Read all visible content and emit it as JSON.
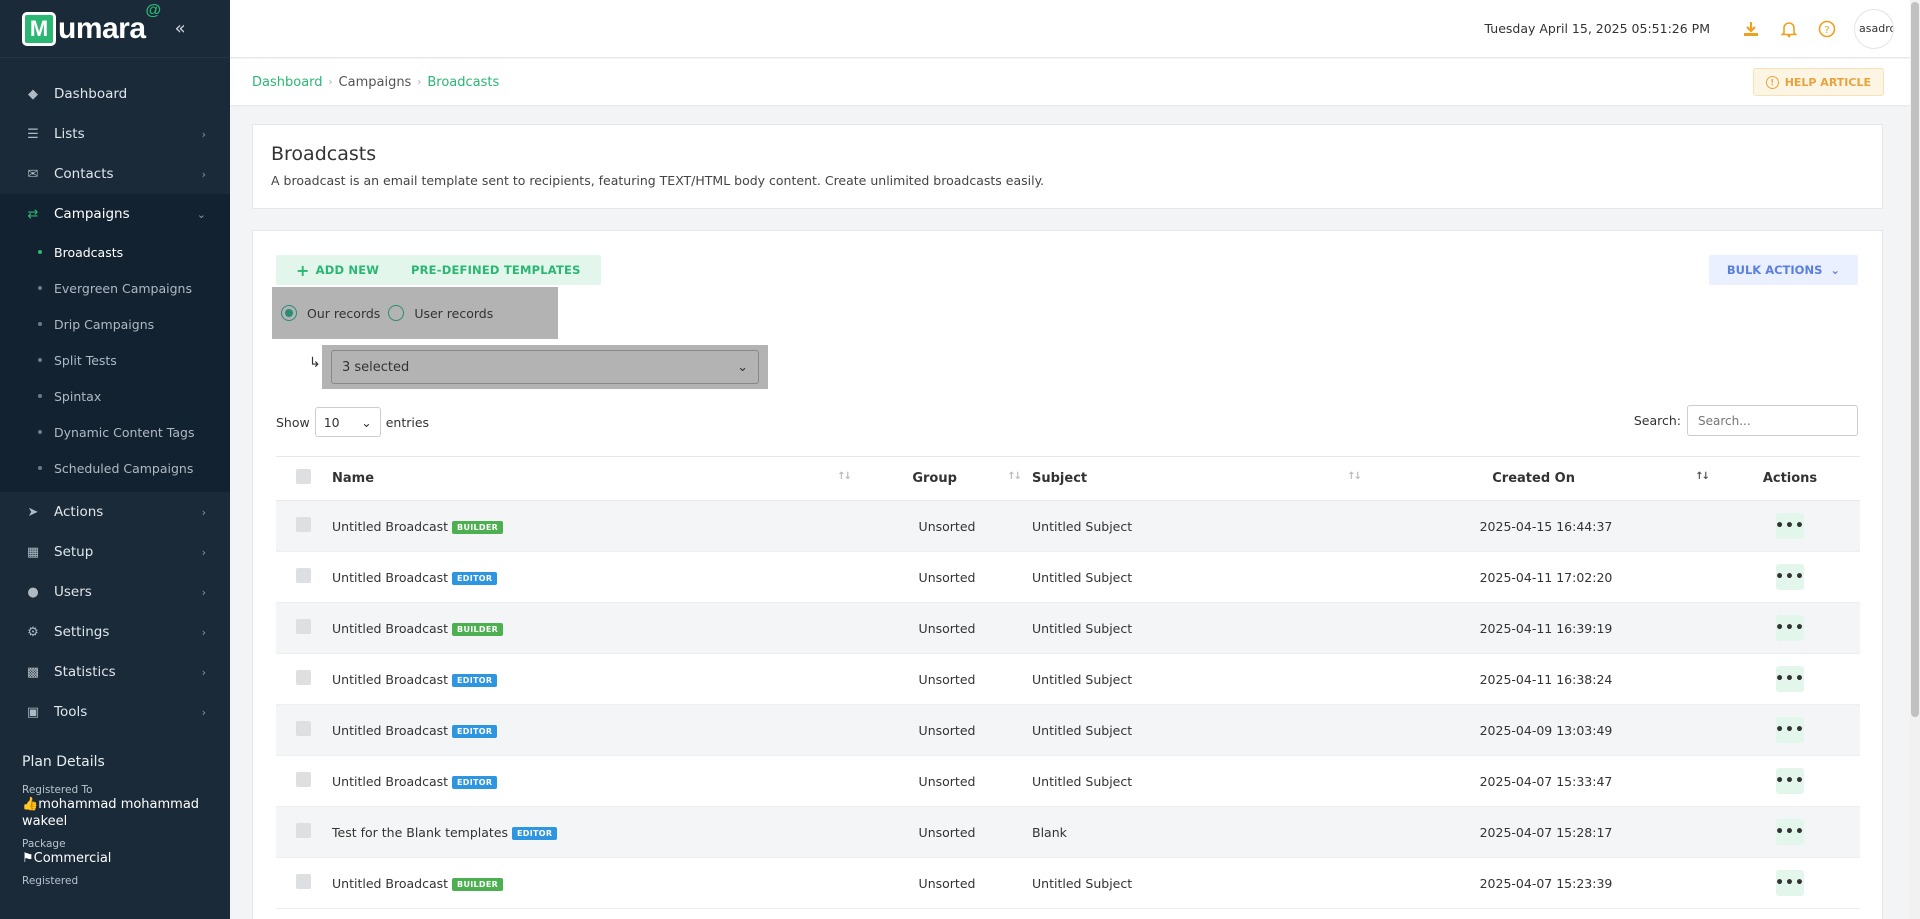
{
  "brand": {
    "letter": "M",
    "name": "umara",
    "sup": "@"
  },
  "topbar": {
    "datetime": "Tuesday April 15, 2025 05:51:26 PM",
    "avatar_alt": "asadro"
  },
  "sidebar": {
    "items": [
      {
        "label": "Dashboard",
        "icon": "diamond-icon"
      },
      {
        "label": "Lists",
        "icon": "list-icon"
      },
      {
        "label": "Contacts",
        "icon": "mail-icon"
      },
      {
        "label": "Campaigns",
        "icon": "campaign-icon"
      },
      {
        "label": "Actions",
        "icon": "actions-icon"
      },
      {
        "label": "Setup",
        "icon": "setup-icon"
      },
      {
        "label": "Users",
        "icon": "user-icon"
      },
      {
        "label": "Settings",
        "icon": "gear-icon"
      },
      {
        "label": "Statistics",
        "icon": "chart-icon"
      },
      {
        "label": "Tools",
        "icon": "tools-icon"
      }
    ],
    "campaign_sub": [
      "Broadcasts",
      "Evergreen Campaigns",
      "Drip Campaigns",
      "Split Tests",
      "Spintax",
      "Dynamic Content Tags",
      "Scheduled Campaigns"
    ],
    "plan": {
      "title": "Plan Details",
      "registered_to_label": "Registered To",
      "registered_to": "mohammad mohammad wakeel",
      "package_label": "Package",
      "package": "Commercial",
      "registered_label": "Registered"
    }
  },
  "breadcrumb": {
    "c1": "Dashboard",
    "c2": "Campaigns",
    "c3": "Broadcasts"
  },
  "help_label": "HELP ARTICLE",
  "header": {
    "title": "Broadcasts",
    "description": "A broadcast is an email template sent to recipients, featuring TEXT/HTML body content. Create unlimited broadcasts easily."
  },
  "toolbar": {
    "add_new": "ADD NEW",
    "predefined": "PRE-DEFINED TEMPLATES",
    "bulk": "BULK ACTIONS"
  },
  "records": {
    "ours": "Our records",
    "users": "User records",
    "selected": "3 selected"
  },
  "table_controls": {
    "show": "Show",
    "length": "10",
    "entries": "entries",
    "search_label": "Search:",
    "search_placeholder": "Search..."
  },
  "columns": {
    "name": "Name",
    "group": "Group",
    "subject": "Subject",
    "created": "Created On",
    "actions": "Actions"
  },
  "rows": [
    {
      "name": "Untitled Broadcast",
      "tag": "BUILDER",
      "group": "Unsorted",
      "subject": "Untitled Subject",
      "created": "2025-04-15 16:44:37"
    },
    {
      "name": "Untitled Broadcast",
      "tag": "EDITOR",
      "group": "Unsorted",
      "subject": "Untitled Subject",
      "created": "2025-04-11 17:02:20"
    },
    {
      "name": "Untitled Broadcast",
      "tag": "BUILDER",
      "group": "Unsorted",
      "subject": "Untitled Subject",
      "created": "2025-04-11 16:39:19"
    },
    {
      "name": "Untitled Broadcast",
      "tag": "EDITOR",
      "group": "Unsorted",
      "subject": "Untitled Subject",
      "created": "2025-04-11 16:38:24"
    },
    {
      "name": "Untitled Broadcast",
      "tag": "EDITOR",
      "group": "Unsorted",
      "subject": "Untitled Subject",
      "created": "2025-04-09 13:03:49"
    },
    {
      "name": "Untitled Broadcast",
      "tag": "EDITOR",
      "group": "Unsorted",
      "subject": "Untitled Subject",
      "created": "2025-04-07 15:33:47"
    },
    {
      "name": "Test for the Blank templates",
      "tag": "EDITOR",
      "group": "Unsorted",
      "subject": "Blank",
      "created": "2025-04-07 15:28:17"
    },
    {
      "name": "Untitled Broadcast",
      "tag": "BUILDER",
      "group": "Unsorted",
      "subject": "Untitled Subject",
      "created": "2025-04-07 15:23:39"
    }
  ],
  "colors": {
    "brand_green": "#2bb673",
    "sidebar_bg": "#1a2a38",
    "builder_tag": "#4caf50",
    "editor_tag": "#2e95e0"
  }
}
